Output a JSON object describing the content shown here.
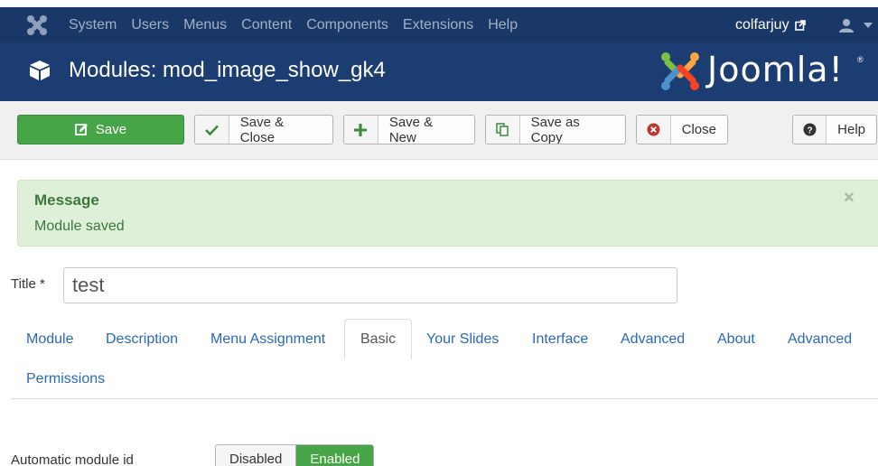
{
  "nav": {
    "menu": [
      "System",
      "Users",
      "Menus",
      "Content",
      "Components",
      "Extensions",
      "Help"
    ],
    "user": "colfarjuy"
  },
  "header": {
    "title": "Modules: mod_image_show_gk4",
    "brand": "Joomla!",
    "brand_mark": "®"
  },
  "toolbar": {
    "save": "Save",
    "save_close": "Save & Close",
    "save_new": "Save & New",
    "save_copy": "Save as Copy",
    "close": "Close",
    "help": "Help"
  },
  "message": {
    "heading": "Message",
    "text": "Module saved",
    "close": "×"
  },
  "form": {
    "title_label": "Title *",
    "title_value": "test"
  },
  "tabs": {
    "row1": [
      "Module",
      "Description",
      "Menu Assignment",
      "Basic",
      "Your Slides",
      "Interface",
      "Advanced",
      "About",
      "Advanced"
    ],
    "row2": [
      "Permissions"
    ],
    "active": "Basic"
  },
  "fields": {
    "auto_id_label": "Automatic module id",
    "disabled": "Disabled",
    "enabled": "Enabled"
  },
  "colors": {
    "navbar": "#1a3867",
    "header": "#1c3d71",
    "success": "#46a546",
    "link": "#2a69b8"
  }
}
